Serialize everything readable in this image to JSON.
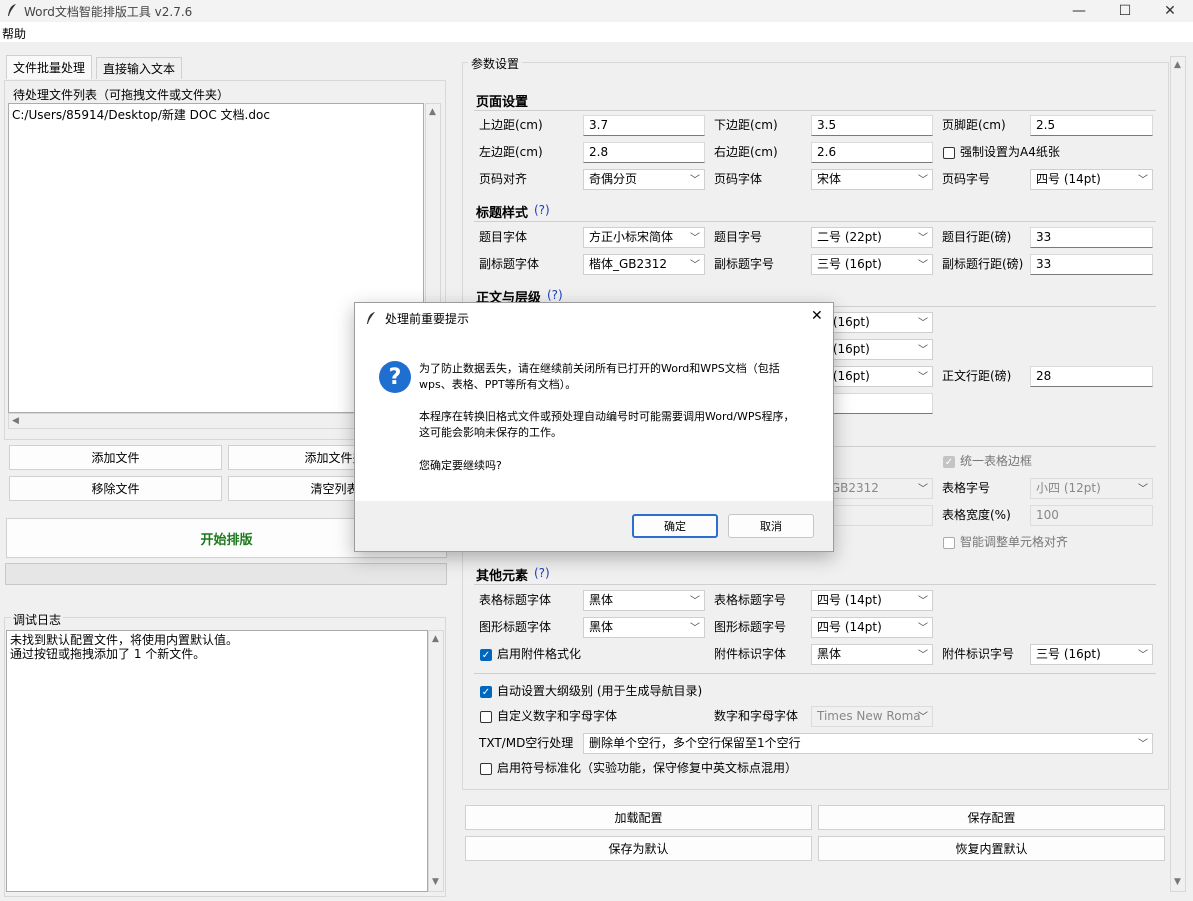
{
  "window": {
    "title": "Word文档智能排版工具 v2.7.6",
    "minimize": "—",
    "maximize": "☐",
    "close": "✕"
  },
  "menu": {
    "help": "帮助"
  },
  "tabs": [
    {
      "label": "文件批量处理"
    },
    {
      "label": "直接输入文本"
    }
  ],
  "file_list": {
    "label": "待处理文件列表（可拖拽文件或文件夹）",
    "items": [
      "C:/Users/85914/Desktop/新建 DOC 文档.doc"
    ]
  },
  "file_buttons": {
    "add_file": "添加文件",
    "add_folder": "添加文件夹",
    "remove_file": "移除文件",
    "clear_list": "清空列表"
  },
  "start_button": "开始排版",
  "log": {
    "label": "调试日志",
    "text": "未找到默认配置文件，将使用内置默认值。\n通过按钮或拖拽添加了 1 个新文件。"
  },
  "settings": {
    "label": "参数设置",
    "page": {
      "title": "页面设置",
      "top_margin_label": "上边距(cm)",
      "top_margin": "3.7",
      "bottom_margin_label": "下边距(cm)",
      "bottom_margin": "3.5",
      "footer_margin_label": "页脚距(cm)",
      "footer_margin": "2.5",
      "left_margin_label": "左边距(cm)",
      "left_margin": "2.8",
      "right_margin_label": "右边距(cm)",
      "right_margin": "2.6",
      "force_a4_label": "强制设置为A4纸张",
      "page_num_align_label": "页码对齐",
      "page_num_align": "奇偶分页",
      "page_num_font_label": "页码字体",
      "page_num_font": "宋体",
      "page_num_size_label": "页码字号",
      "page_num_size": "四号 (14pt)"
    },
    "heading": {
      "title": "标题样式",
      "help": "(?)",
      "title_font_label": "题目字体",
      "title_font": "方正小标宋简体",
      "title_size_label": "题目字号",
      "title_size": "二号 (22pt)",
      "title_spacing_label": "题目行距(磅)",
      "title_spacing": "33",
      "subtitle_font_label": "副标题字体",
      "subtitle_font": "楷体_GB2312",
      "subtitle_size_label": "副标题字号",
      "subtitle_size": "三号 (16pt)",
      "subtitle_spacing_label": "副标题行距(磅)",
      "subtitle_spacing": "33"
    },
    "body": {
      "title": "正文与层级",
      "help": "(?)",
      "size_a": "号 (16pt)",
      "size_b": "号 (16pt)",
      "size_c": "号 (16pt)",
      "body_spacing_label": "正文行距(磅)",
      "body_spacing": "28"
    },
    "table": {
      "unify_border_label": "统一表格边框",
      "font": "K_GB2312",
      "size_label": "表格字号",
      "size": "小四 (12pt)",
      "width_label": "表格宽度(%)",
      "width": "100",
      "smart_align_label": "智能调整单元格对齐"
    },
    "other": {
      "title": "其他元素",
      "help": "(?)",
      "table_title_font_label": "表格标题字体",
      "table_title_font": "黑体",
      "table_title_size_label": "表格标题字号",
      "table_title_size": "四号 (14pt)",
      "figure_title_font_label": "图形标题字体",
      "figure_title_font": "黑体",
      "figure_title_size_label": "图形标题字号",
      "figure_title_size": "四号 (14pt)",
      "attachment_format_label": "启用附件格式化",
      "attachment_font_label": "附件标识字体",
      "attachment_font": "黑体",
      "attachment_size_label": "附件标识字号",
      "attachment_size": "三号 (16pt)"
    },
    "misc": {
      "outline_label": "自动设置大纲级别 (用于生成导航目录)",
      "custom_alnum_label": "自定义数字和字母字体",
      "alnum_font_label": "数字和字母字体",
      "alnum_font": "Times New Roma",
      "blank_line_label": "TXT/MD空行处理",
      "blank_line": "删除单个空行，多个空行保留至1个空行",
      "punct_label": "启用符号标准化（实验功能，保守修复中英文标点混用）"
    }
  },
  "config_buttons": {
    "load": "加载配置",
    "save": "保存配置",
    "save_default": "保存为默认",
    "restore": "恢复内置默认"
  },
  "dialog": {
    "title": "处理前重要提示",
    "line1": "为了防止数据丢失，请在继续前关闭所有已打开的Word和WPS文档（包括",
    "line2": "wps、表格、PPT等所有文档）。",
    "line3": "本程序在转换旧格式文件或预处理自动编号时可能需要调用Word/WPS程序，",
    "line4": "这可能会影响未保存的工作。",
    "line5": "您确定要继续吗?",
    "ok": "确定",
    "cancel": "取消"
  }
}
